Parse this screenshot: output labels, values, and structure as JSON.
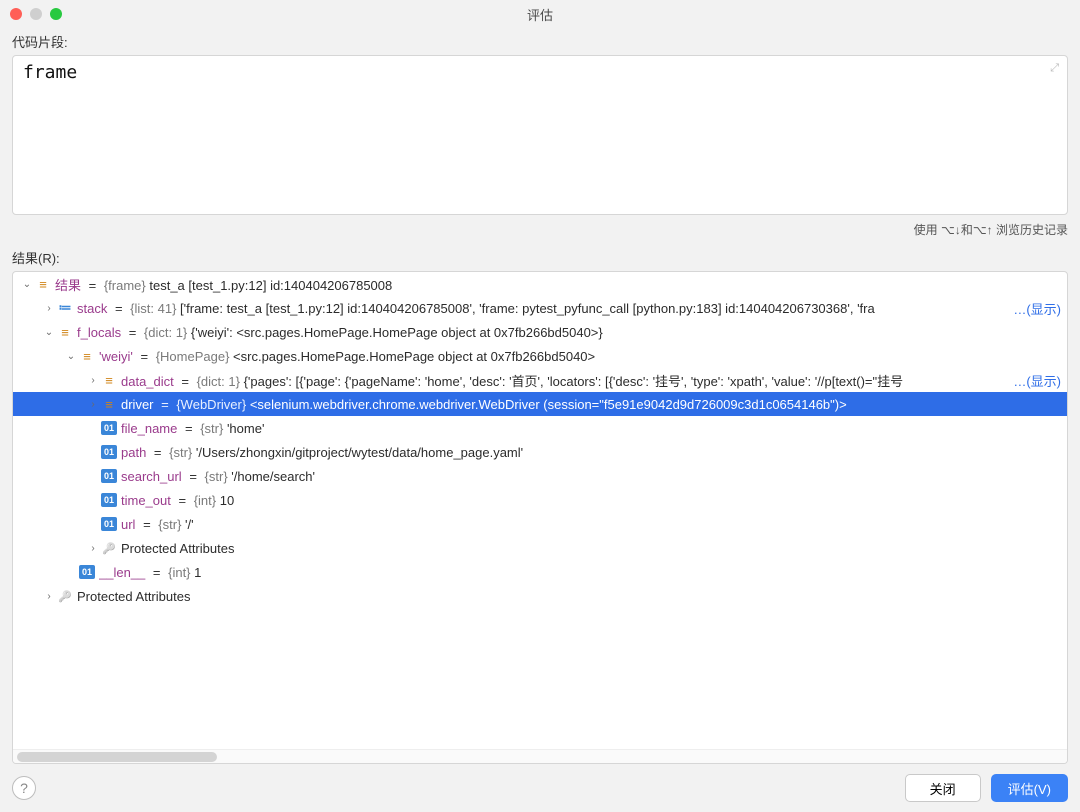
{
  "window": {
    "title": "评估"
  },
  "labels": {
    "code": "代码片段:",
    "results": "结果(R):",
    "hint": "使用 ⌥↓和⌥↑ 浏览历史记录"
  },
  "code": {
    "text": "frame"
  },
  "tree": [
    {
      "depth": 0,
      "expand": "open",
      "icon": "obj",
      "name": "结果",
      "type": "{frame}",
      "value": "test_a [test_1.py:12]  id:140404206785008",
      "sel": false
    },
    {
      "depth": 1,
      "expand": "closed",
      "icon": "stack",
      "name": "stack",
      "type": "{list: 41}",
      "value": "['frame: test_a [test_1.py:12]  id:140404206785008', 'frame: pytest_pyfunc_call [python.py:183]  id:140404206730368', 'fra",
      "sel": false,
      "show": true
    },
    {
      "depth": 1,
      "expand": "open",
      "icon": "obj",
      "name": "f_locals",
      "type": "{dict: 1}",
      "value": "{'weiyi': <src.pages.HomePage.HomePage object at 0x7fb266bd5040>}",
      "sel": false
    },
    {
      "depth": 2,
      "expand": "open",
      "icon": "obj",
      "name": "'weiyi'",
      "type": "{HomePage}",
      "value": "<src.pages.HomePage.HomePage object at 0x7fb266bd5040>",
      "sel": false
    },
    {
      "depth": 3,
      "expand": "closed",
      "icon": "obj",
      "name": "data_dict",
      "type": "{dict: 1}",
      "value": "{'pages': [{'page': {'pageName': 'home', 'desc': '首页', 'locators': [{'desc': '挂号', 'type': 'xpath', 'value': '//p[text()=\"挂号",
      "sel": false,
      "show": true
    },
    {
      "depth": 3,
      "expand": "closed",
      "icon": "obj",
      "name": "driver",
      "type": "{WebDriver}",
      "value": "<selenium.webdriver.chrome.webdriver.WebDriver (session=\"f5e91e9042d9d726009c3d1c0654146b\")>",
      "sel": true
    },
    {
      "depth": 3,
      "expand": "none",
      "icon": "str",
      "name": "file_name",
      "type": "{str}",
      "value": "'home'",
      "sel": false
    },
    {
      "depth": 3,
      "expand": "none",
      "icon": "str",
      "name": "path",
      "type": "{str}",
      "value": "'/Users/zhongxin/gitproject/wytest/data/home_page.yaml'",
      "sel": false
    },
    {
      "depth": 3,
      "expand": "none",
      "icon": "str",
      "name": "search_url",
      "type": "{str}",
      "value": "'/home/search'",
      "sel": false
    },
    {
      "depth": 3,
      "expand": "none",
      "icon": "str",
      "name": "time_out",
      "type": "{int}",
      "value": "10",
      "sel": false
    },
    {
      "depth": 3,
      "expand": "none",
      "icon": "str",
      "name": "url",
      "type": "{str}",
      "value": "'/'",
      "sel": false
    },
    {
      "depth": 3,
      "expand": "closed",
      "icon": "key",
      "name": "",
      "type": "",
      "value": "Protected Attributes",
      "sel": false,
      "plain": true
    },
    {
      "depth": 2,
      "expand": "none",
      "icon": "str",
      "name": "__len__",
      "type": "{int}",
      "value": "1",
      "sel": false
    },
    {
      "depth": 1,
      "expand": "closed",
      "icon": "key",
      "name": "",
      "type": "",
      "value": "Protected Attributes",
      "sel": false,
      "plain": true
    }
  ],
  "link": {
    "show": "…(显示)"
  },
  "buttons": {
    "close": "关闭",
    "evaluate": "评估(V)"
  }
}
